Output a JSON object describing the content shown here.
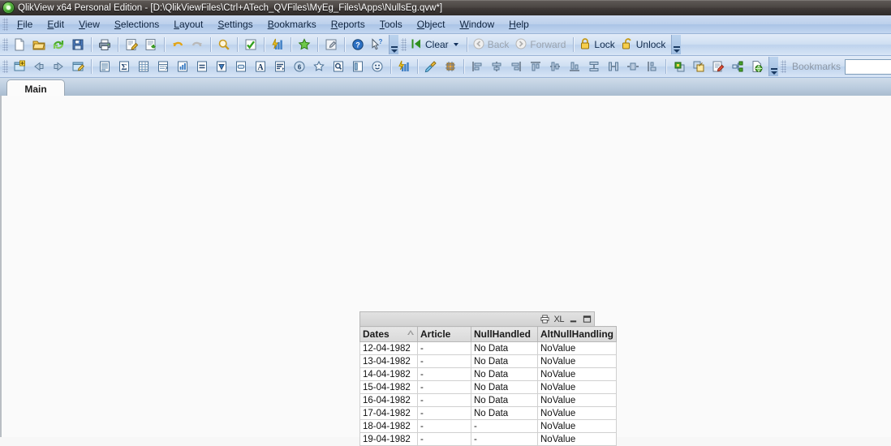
{
  "window": {
    "app_icon": "qlikview-logo-icon",
    "title": "QlikView x64 Personal Edition - [D:\\QlikViewFiles\\Ctrl+ATech_QVFiles\\MyEg_Files\\Apps\\NullsEg.qvw*]"
  },
  "menu": {
    "items": [
      {
        "label": "File",
        "mnemonic": "F"
      },
      {
        "label": "Edit",
        "mnemonic": "E"
      },
      {
        "label": "View",
        "mnemonic": "V"
      },
      {
        "label": "Selections",
        "mnemonic": "S"
      },
      {
        "label": "Layout",
        "mnemonic": "L"
      },
      {
        "label": "Settings",
        "mnemonic": "S"
      },
      {
        "label": "Bookmarks",
        "mnemonic": "B"
      },
      {
        "label": "Reports",
        "mnemonic": "R"
      },
      {
        "label": "Tools",
        "mnemonic": "T"
      },
      {
        "label": "Object",
        "mnemonic": "O"
      },
      {
        "label": "Window",
        "mnemonic": "W"
      },
      {
        "label": "Help",
        "mnemonic": "H"
      }
    ]
  },
  "standard_toolbar": {
    "icons": [
      "new-document-icon",
      "open-folder-icon",
      "reload-icon",
      "save-icon",
      "print-icon",
      "edit-script-icon",
      "export-icon",
      "undo-icon",
      "redo-icon",
      "search-icon",
      "current-selections-icon",
      "quick-chart-icon",
      "favorite-icon",
      "design-grid-icon",
      "help-icon",
      "whats-this-icon"
    ],
    "clear_label": "Clear",
    "back_label": "Back",
    "forward_label": "Forward",
    "lock_label": "Lock",
    "unlock_label": "Unlock",
    "back_enabled": "false",
    "forward_enabled": "false"
  },
  "design_toolbar": {
    "icons": [
      "new-sheet-icon",
      "promote-sheet-icon",
      "demote-sheet-icon",
      "sheet-properties-icon",
      "list-box-icon",
      "statistics-box-icon",
      "multi-box-icon",
      "table-box-icon",
      "chart-icon",
      "input-box-icon",
      "current-selections-box-icon",
      "button-icon",
      "text-object-icon",
      "slider-calendar-icon",
      "bookmark-object-icon",
      "container-icon",
      "search-object-icon",
      "line-arrow-icon",
      "custom-object-icon",
      "chart-wizard-icon",
      "format-painter-icon",
      "design-grid-toggle-icon",
      "align-left-icon",
      "align-center-h-icon",
      "align-right-icon",
      "align-top-icon",
      "align-center-v-icon",
      "align-bottom-icon",
      "space-vertical-icon",
      "space-horizontal-icon",
      "shrink-horizontal-icon",
      "stretch-vertical-icon",
      "move-to-back-icon",
      "move-to-front-icon",
      "edit-module-icon",
      "share-icon",
      "web-publish-icon"
    ]
  },
  "bookmarks_toolbar": {
    "label": "Bookmarks",
    "selected_value": "",
    "dropdown_icon": "chevron-down-icon",
    "add-bookmark-icon": "favorite-icon"
  },
  "sheet_tabs": {
    "tabs": [
      {
        "label": "Main",
        "active": "true"
      }
    ]
  },
  "table_object": {
    "caption_icons": [
      "print-icon",
      "export-to-excel-icon",
      "minimize-icon",
      "maximize-icon"
    ],
    "export_label": "XL",
    "sort_indicator_column": "Dates",
    "columns": [
      "Dates",
      "Article",
      "NullHandled",
      "AltNullHandling"
    ],
    "rows": [
      [
        "12-04-1982",
        "-",
        "No Data",
        "NoValue"
      ],
      [
        "13-04-1982",
        "-",
        "No Data",
        "NoValue"
      ],
      [
        "14-04-1982",
        "-",
        "No Data",
        "NoValue"
      ],
      [
        "15-04-1982",
        "-",
        "No Data",
        "NoValue"
      ],
      [
        "16-04-1982",
        "-",
        "No Data",
        "NoValue"
      ],
      [
        "17-04-1982",
        "-",
        "No Data",
        "NoValue"
      ],
      [
        "18-04-1982",
        "-",
        "-",
        "NoValue"
      ],
      [
        "19-04-1982",
        "-",
        "-",
        "NoValue"
      ]
    ]
  },
  "colors": {
    "titlebar": "#3f3a38",
    "menubar": "#bcd0ec",
    "toolbar": "#cfdff2",
    "sheet_background": "#fafafa",
    "table_header": "#dedede",
    "accent_green": "#45b02a"
  }
}
